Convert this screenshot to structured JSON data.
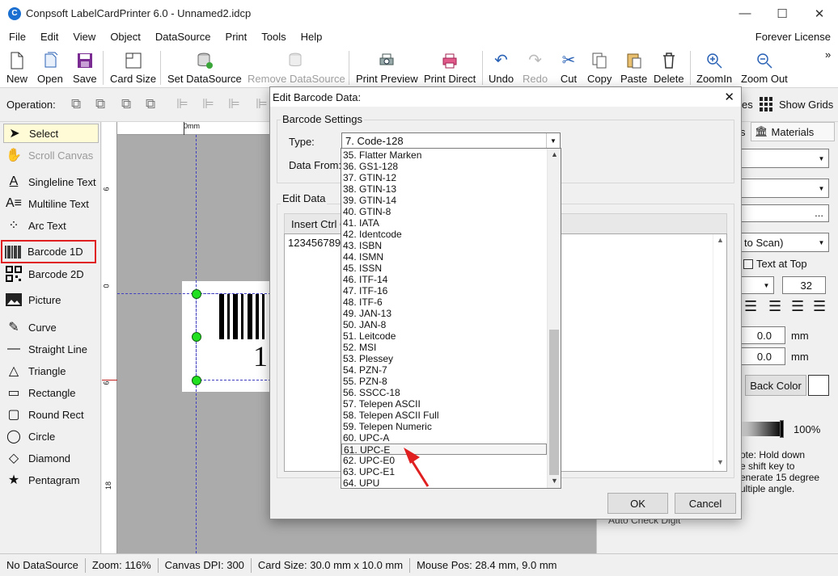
{
  "app": {
    "title": "Conpsoft LabelCardPrinter 6.0 - Unnamed2.idcp",
    "icon": "app-logo-icon",
    "license": "Forever License"
  },
  "window_controls": {
    "minimize": "—",
    "maximize": "☐",
    "close": "✕"
  },
  "menu": [
    "File",
    "Edit",
    "View",
    "Object",
    "DataSource",
    "Print",
    "Tools",
    "Help"
  ],
  "toolbar": {
    "new": "New",
    "open": "Open",
    "save": "Save",
    "card_size": "Card Size",
    "set_datasource": "Set DataSource",
    "remove_datasource": "Remove DataSource",
    "print_preview": "Print Preview",
    "print_direct": "Print Direct",
    "undo": "Undo",
    "redo": "Redo",
    "cut": "Cut",
    "copy": "Copy",
    "paste": "Paste",
    "delete": "Delete",
    "zoom_in": "ZoomIn",
    "zoom_out": "Zoom Out",
    "overflow": "»"
  },
  "opbar": {
    "label": "Operation:",
    "right_label_1": "es",
    "show_grids": "Show Grids"
  },
  "tools": [
    {
      "label": "Select"
    },
    {
      "label": "Scroll Canvas"
    },
    {
      "label": "Singleline Text"
    },
    {
      "label": "Multiline Text"
    },
    {
      "label": "Arc Text"
    },
    {
      "label": "Barcode 1D"
    },
    {
      "label": "Barcode 2D"
    },
    {
      "label": "Picture"
    },
    {
      "label": "Curve"
    },
    {
      "label": "Straight Line"
    },
    {
      "label": "Triangle"
    },
    {
      "label": "Rectangle"
    },
    {
      "label": "Round Rect"
    },
    {
      "label": "Circle"
    },
    {
      "label": "Diamond"
    },
    {
      "label": "Pentagram"
    }
  ],
  "canvas": {
    "ruler_h_label": "0mm",
    "ruler_v_labels": [
      "6",
      "0",
      "6",
      "18"
    ],
    "barcode_text": "1"
  },
  "rightpanel": {
    "tab_partial": "s",
    "materials": "Materials",
    "auto_scan": "to Scan)",
    "text_at_top": "Text at Top",
    "font_size": "32",
    "x_value": "0.0",
    "y_value": "0.0",
    "unit": "mm",
    "back_color": "Back Color",
    "opacity": "100%",
    "note": "ote: Hold down\ne shift key to\nenerate 15 degree\nultiple angle.",
    "auto_check_digit": "Auto Check Digit"
  },
  "status": {
    "datasource": "No DataSource",
    "zoom": "Zoom: 116%",
    "dpi": "Canvas DPI: 300",
    "card_size": "Card Size: 30.0 mm x 10.0 mm",
    "mouse_pos": "Mouse Pos: 28.4 mm, 9.0 mm"
  },
  "dialog": {
    "title": "Edit Barcode Data:",
    "settings_group": "Barcode Settings",
    "type_label": "Type:",
    "type_value": "7.  Code-128",
    "data_from_label": "Data From:",
    "edit_data_group": "Edit Data",
    "insert_ctrl": "Insert Ctrl C",
    "data_value": "123456789",
    "ok": "OK",
    "cancel": "Cancel"
  },
  "dropdown": {
    "items": [
      "35.  Flatter Marken",
      "36.  GS1-128",
      "37.  GTIN-12",
      "38.  GTIN-13",
      "39.  GTIN-14",
      "40.  GTIN-8",
      "41.  IATA",
      "42.  Identcode",
      "43.  ISBN",
      "44.  ISMN",
      "45.  ISSN",
      "46.  ITF-14",
      "47.  ITF-16",
      "48.  ITF-6",
      "49.  JAN-13",
      "50.  JAN-8",
      "51.  Leitcode",
      "52.  MSI",
      "53.  Plessey",
      "54.  PZN-7",
      "55.  PZN-8",
      "56.  SSCC-18",
      "57.  Telepen ASCII",
      "58.  Telepen ASCII Full",
      "59.  Telepen Numeric",
      "60.  UPC-A",
      "61.  UPC-E",
      "62.  UPC-E0",
      "63.  UPC-E1",
      "64.  UPU"
    ],
    "selected_index": 26,
    "highlight_color": "#e02020"
  }
}
